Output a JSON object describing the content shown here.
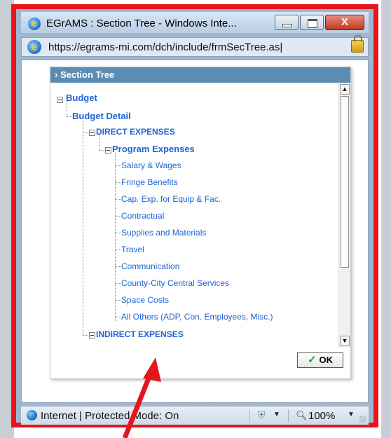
{
  "window": {
    "title": "EGrAMS : Section Tree - Windows Inte...",
    "close_glyph": "X"
  },
  "address": {
    "url": "https://egrams-mi.com/dch/include/frmSecTree.as|"
  },
  "dialog": {
    "header": "Section Tree",
    "ok_label": "OK",
    "tree": {
      "root": "Budget",
      "detail": "Budget Detail",
      "direct": "DIRECT EXPENSES",
      "program": "Program Expenses",
      "items": [
        "Salary & Wages",
        "Fringe Benefits",
        "Cap. Exp. for Equip & Fac.",
        "Contractual",
        "Supplies and Materials",
        "Travel",
        "Communication",
        "County-City Central Services",
        "Space Costs",
        "All Others (ADP, Con. Employees, Misc.)"
      ],
      "indirect": "INDIRECT EXPENSES"
    }
  },
  "status": {
    "zone": "Internet | Protected Mode: On",
    "zoom": "100%"
  },
  "colors": {
    "annotation_red": "#e8141b",
    "link_blue": "#1f63d6",
    "header_blue": "#5b8db4"
  }
}
